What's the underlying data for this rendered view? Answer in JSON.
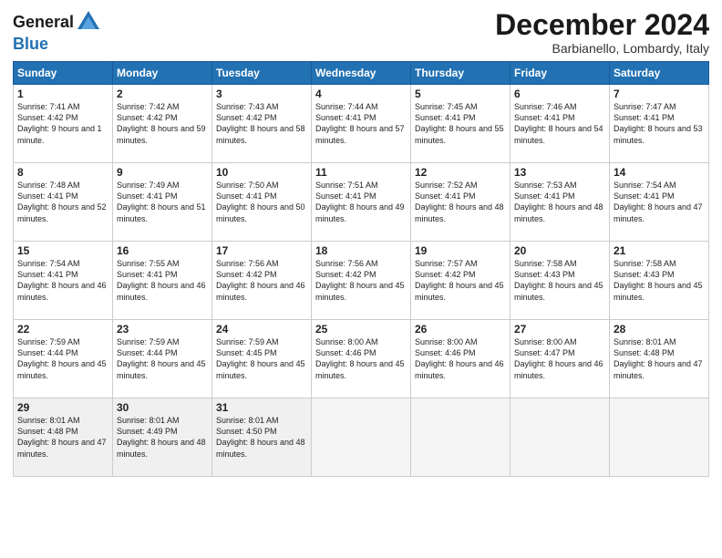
{
  "logo": {
    "general": "General",
    "blue": "Blue"
  },
  "title": "December 2024",
  "subtitle": "Barbianello, Lombardy, Italy",
  "days_header": [
    "Sunday",
    "Monday",
    "Tuesday",
    "Wednesday",
    "Thursday",
    "Friday",
    "Saturday"
  ],
  "weeks": [
    [
      {
        "day": "1",
        "content": "Sunrise: 7:41 AM\nSunset: 4:42 PM\nDaylight: 9 hours\nand 1 minute."
      },
      {
        "day": "2",
        "content": "Sunrise: 7:42 AM\nSunset: 4:42 PM\nDaylight: 8 hours\nand 59 minutes."
      },
      {
        "day": "3",
        "content": "Sunrise: 7:43 AM\nSunset: 4:42 PM\nDaylight: 8 hours\nand 58 minutes."
      },
      {
        "day": "4",
        "content": "Sunrise: 7:44 AM\nSunset: 4:41 PM\nDaylight: 8 hours\nand 57 minutes."
      },
      {
        "day": "5",
        "content": "Sunrise: 7:45 AM\nSunset: 4:41 PM\nDaylight: 8 hours\nand 55 minutes."
      },
      {
        "day": "6",
        "content": "Sunrise: 7:46 AM\nSunset: 4:41 PM\nDaylight: 8 hours\nand 54 minutes."
      },
      {
        "day": "7",
        "content": "Sunrise: 7:47 AM\nSunset: 4:41 PM\nDaylight: 8 hours\nand 53 minutes."
      }
    ],
    [
      {
        "day": "8",
        "content": "Sunrise: 7:48 AM\nSunset: 4:41 PM\nDaylight: 8 hours\nand 52 minutes."
      },
      {
        "day": "9",
        "content": "Sunrise: 7:49 AM\nSunset: 4:41 PM\nDaylight: 8 hours\nand 51 minutes."
      },
      {
        "day": "10",
        "content": "Sunrise: 7:50 AM\nSunset: 4:41 PM\nDaylight: 8 hours\nand 50 minutes."
      },
      {
        "day": "11",
        "content": "Sunrise: 7:51 AM\nSunset: 4:41 PM\nDaylight: 8 hours\nand 49 minutes."
      },
      {
        "day": "12",
        "content": "Sunrise: 7:52 AM\nSunset: 4:41 PM\nDaylight: 8 hours\nand 48 minutes."
      },
      {
        "day": "13",
        "content": "Sunrise: 7:53 AM\nSunset: 4:41 PM\nDaylight: 8 hours\nand 48 minutes."
      },
      {
        "day": "14",
        "content": "Sunrise: 7:54 AM\nSunset: 4:41 PM\nDaylight: 8 hours\nand 47 minutes."
      }
    ],
    [
      {
        "day": "15",
        "content": "Sunrise: 7:54 AM\nSunset: 4:41 PM\nDaylight: 8 hours\nand 46 minutes."
      },
      {
        "day": "16",
        "content": "Sunrise: 7:55 AM\nSunset: 4:41 PM\nDaylight: 8 hours\nand 46 minutes."
      },
      {
        "day": "17",
        "content": "Sunrise: 7:56 AM\nSunset: 4:42 PM\nDaylight: 8 hours\nand 46 minutes."
      },
      {
        "day": "18",
        "content": "Sunrise: 7:56 AM\nSunset: 4:42 PM\nDaylight: 8 hours\nand 45 minutes."
      },
      {
        "day": "19",
        "content": "Sunrise: 7:57 AM\nSunset: 4:42 PM\nDaylight: 8 hours\nand 45 minutes."
      },
      {
        "day": "20",
        "content": "Sunrise: 7:58 AM\nSunset: 4:43 PM\nDaylight: 8 hours\nand 45 minutes."
      },
      {
        "day": "21",
        "content": "Sunrise: 7:58 AM\nSunset: 4:43 PM\nDaylight: 8 hours\nand 45 minutes."
      }
    ],
    [
      {
        "day": "22",
        "content": "Sunrise: 7:59 AM\nSunset: 4:44 PM\nDaylight: 8 hours\nand 45 minutes."
      },
      {
        "day": "23",
        "content": "Sunrise: 7:59 AM\nSunset: 4:44 PM\nDaylight: 8 hours\nand 45 minutes."
      },
      {
        "day": "24",
        "content": "Sunrise: 7:59 AM\nSunset: 4:45 PM\nDaylight: 8 hours\nand 45 minutes."
      },
      {
        "day": "25",
        "content": "Sunrise: 8:00 AM\nSunset: 4:46 PM\nDaylight: 8 hours\nand 45 minutes."
      },
      {
        "day": "26",
        "content": "Sunrise: 8:00 AM\nSunset: 4:46 PM\nDaylight: 8 hours\nand 46 minutes."
      },
      {
        "day": "27",
        "content": "Sunrise: 8:00 AM\nSunset: 4:47 PM\nDaylight: 8 hours\nand 46 minutes."
      },
      {
        "day": "28",
        "content": "Sunrise: 8:01 AM\nSunset: 4:48 PM\nDaylight: 8 hours\nand 47 minutes."
      }
    ],
    [
      {
        "day": "29",
        "content": "Sunrise: 8:01 AM\nSunset: 4:48 PM\nDaylight: 8 hours\nand 47 minutes."
      },
      {
        "day": "30",
        "content": "Sunrise: 8:01 AM\nSunset: 4:49 PM\nDaylight: 8 hours\nand 48 minutes."
      },
      {
        "day": "31",
        "content": "Sunrise: 8:01 AM\nSunset: 4:50 PM\nDaylight: 8 hours\nand 48 minutes."
      },
      {
        "day": "",
        "content": ""
      },
      {
        "day": "",
        "content": ""
      },
      {
        "day": "",
        "content": ""
      },
      {
        "day": "",
        "content": ""
      }
    ]
  ]
}
